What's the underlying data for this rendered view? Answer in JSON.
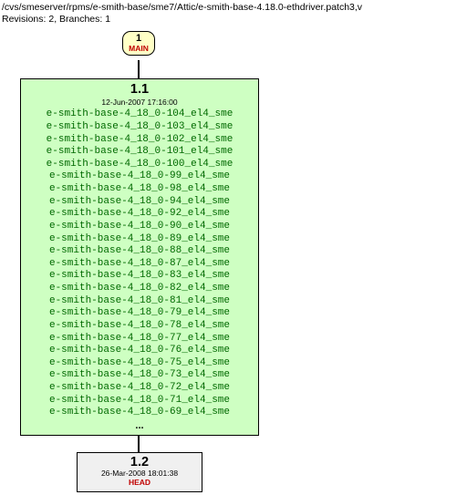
{
  "header": {
    "path": "/cvs/smeserver/rpms/e-smith-base/sme7/Attic/e-smith-base-4.18.0-ethdriver.patch3,v",
    "info": "Revisions: 2, Branches: 1"
  },
  "main_node": {
    "number": "1",
    "label": "MAIN"
  },
  "rev1": {
    "version": "1.1",
    "date": "12-Jun-2007 17:16:00",
    "tags": [
      "e-smith-base-4_18_0-104_el4_sme",
      "e-smith-base-4_18_0-103_el4_sme",
      "e-smith-base-4_18_0-102_el4_sme",
      "e-smith-base-4_18_0-101_el4_sme",
      "e-smith-base-4_18_0-100_el4_sme",
      "e-smith-base-4_18_0-99_el4_sme",
      "e-smith-base-4_18_0-98_el4_sme",
      "e-smith-base-4_18_0-94_el4_sme",
      "e-smith-base-4_18_0-92_el4_sme",
      "e-smith-base-4_18_0-90_el4_sme",
      "e-smith-base-4_18_0-89_el4_sme",
      "e-smith-base-4_18_0-88_el4_sme",
      "e-smith-base-4_18_0-87_el4_sme",
      "e-smith-base-4_18_0-83_el4_sme",
      "e-smith-base-4_18_0-82_el4_sme",
      "e-smith-base-4_18_0-81_el4_sme",
      "e-smith-base-4_18_0-79_el4_sme",
      "e-smith-base-4_18_0-78_el4_sme",
      "e-smith-base-4_18_0-77_el4_sme",
      "e-smith-base-4_18_0-76_el4_sme",
      "e-smith-base-4_18_0-75_el4_sme",
      "e-smith-base-4_18_0-73_el4_sme",
      "e-smith-base-4_18_0-72_el4_sme",
      "e-smith-base-4_18_0-71_el4_sme",
      "e-smith-base-4_18_0-69_el4_sme"
    ],
    "ellipsis": "..."
  },
  "rev2": {
    "version": "1.2",
    "date": "26-Mar-2008 18:01:38",
    "head": "HEAD"
  }
}
